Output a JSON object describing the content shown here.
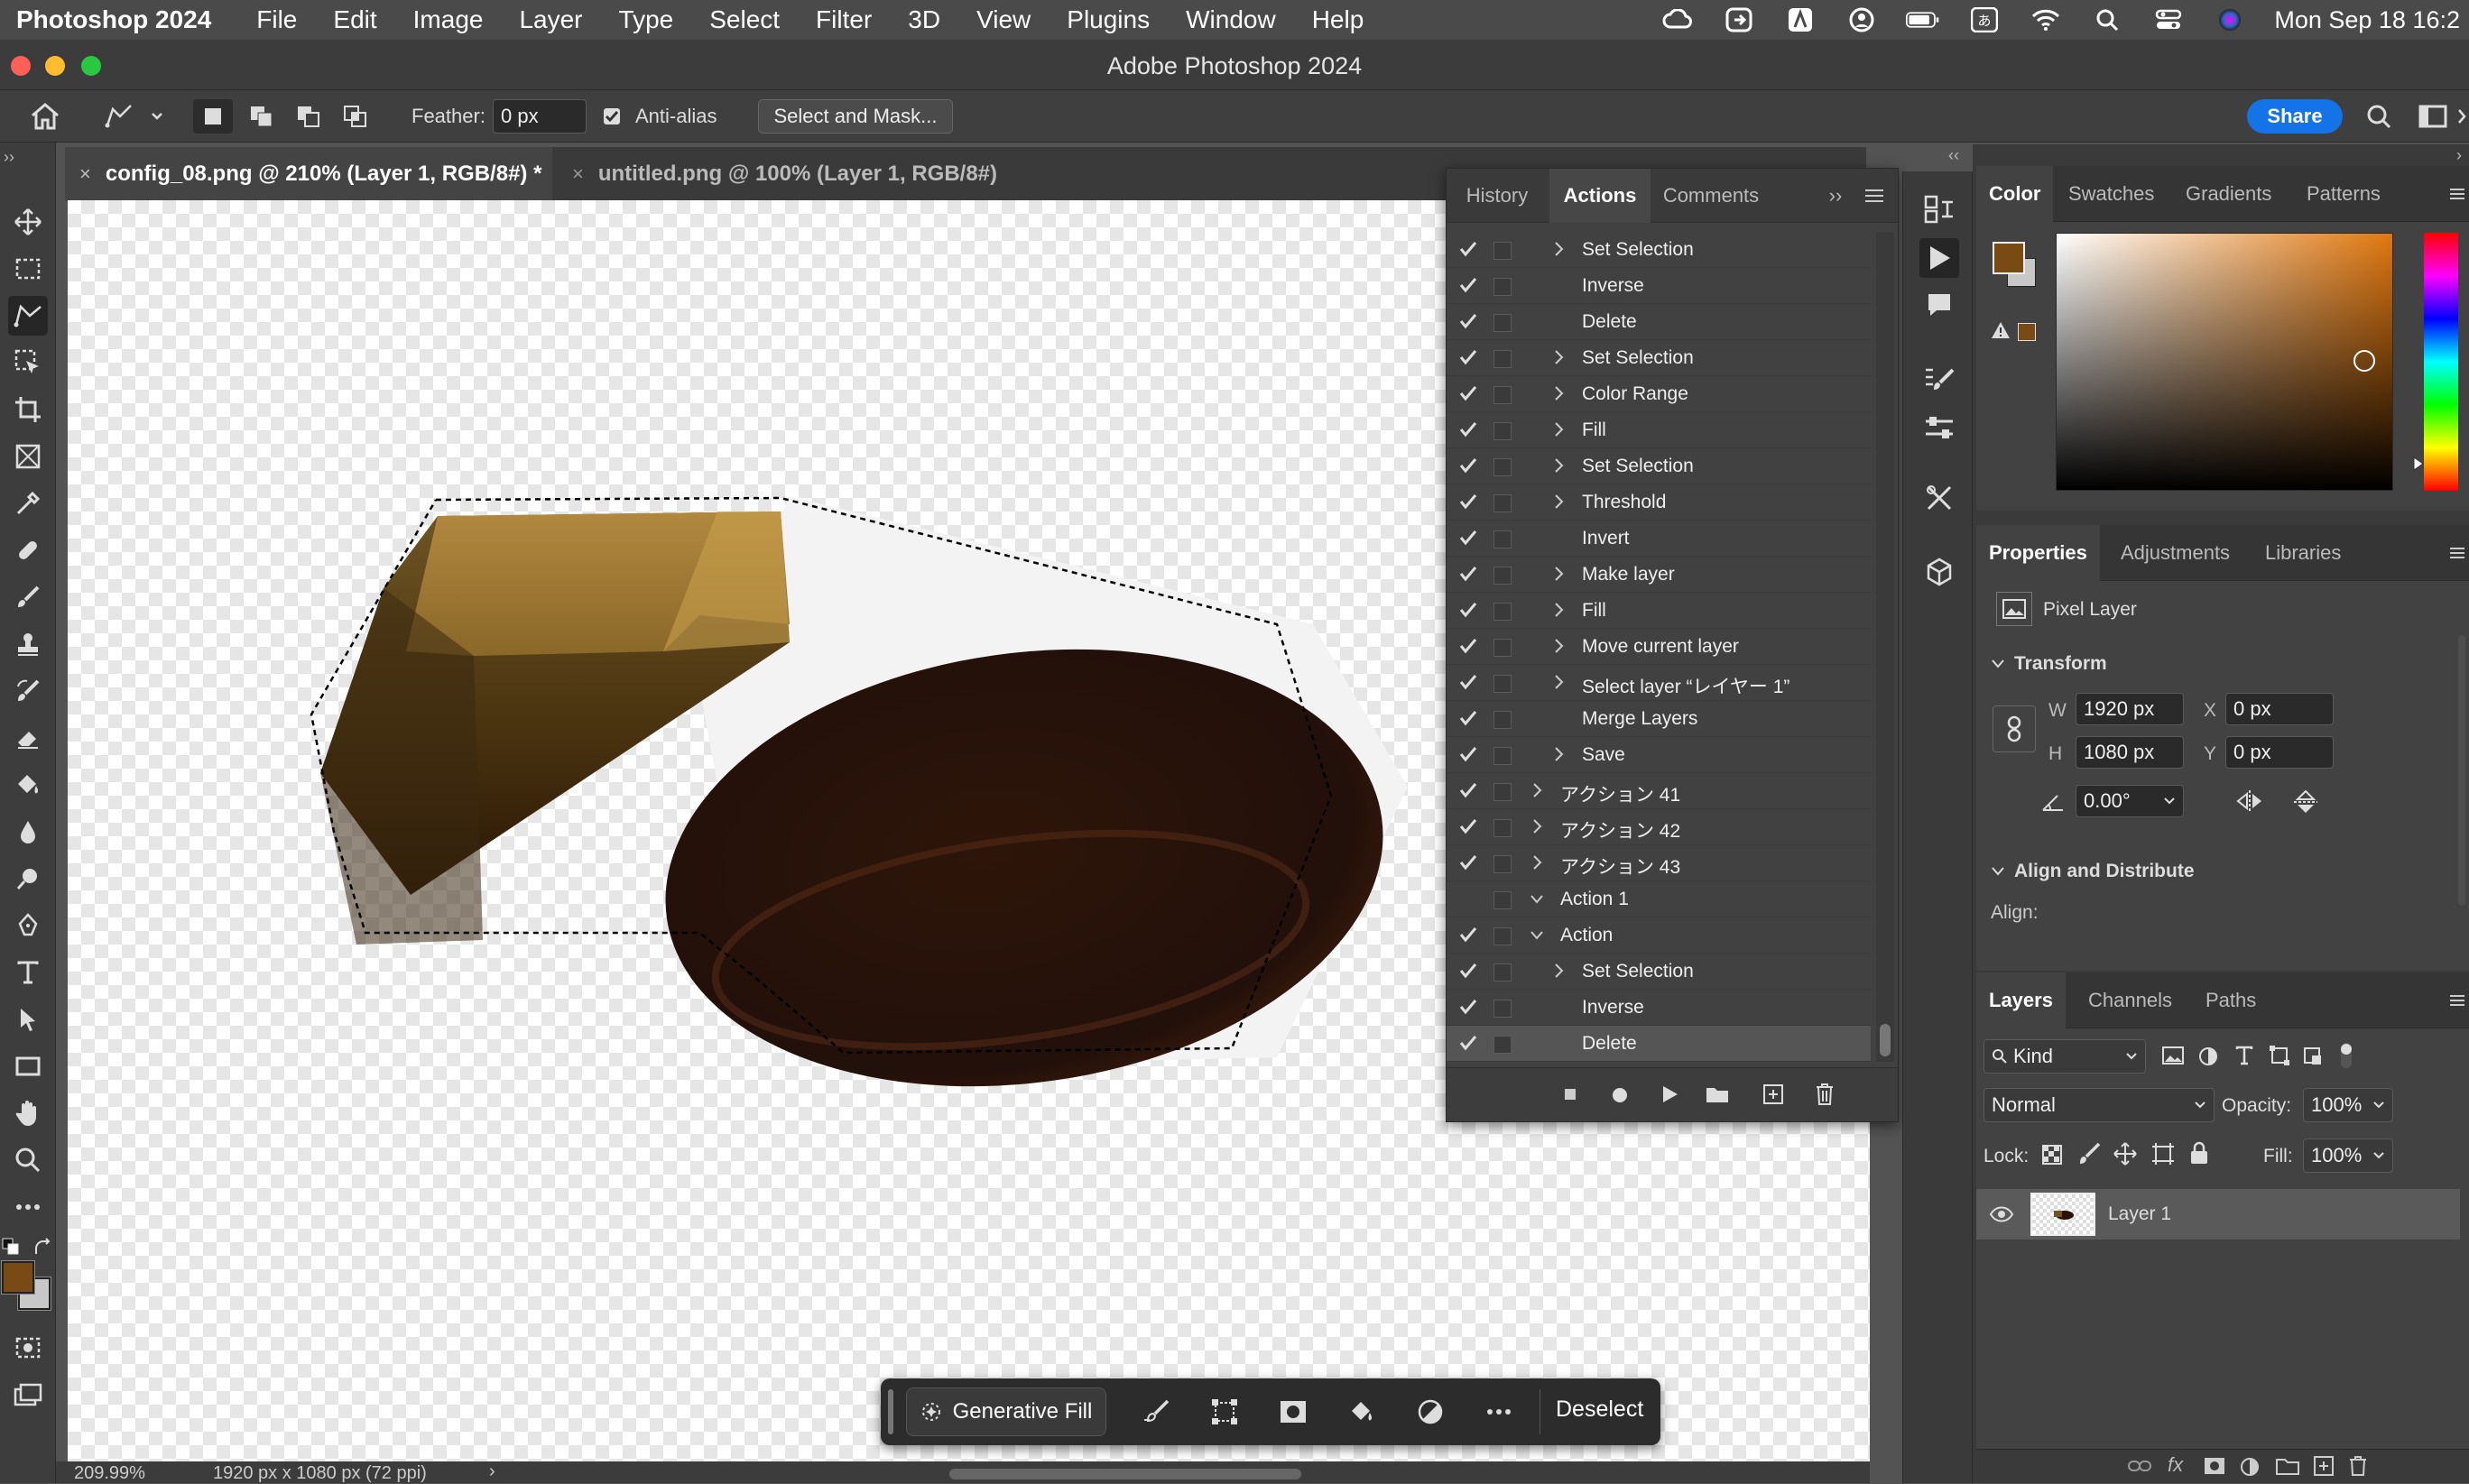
{
  "menubar": {
    "app_name": "Photoshop 2024",
    "menus": [
      "File",
      "Edit",
      "Image",
      "Layer",
      "Type",
      "Select",
      "Filter",
      "3D",
      "View",
      "Plugins",
      "Window",
      "Help"
    ],
    "clock": "Mon Sep 18  16:2"
  },
  "window": {
    "title": "Adobe Photoshop 2024"
  },
  "options_bar": {
    "feather_label": "Feather:",
    "feather_value": "0 px",
    "antialias_label": "Anti-alias",
    "antialias_checked": true,
    "select_mask_label": "Select and Mask...",
    "share_label": "Share"
  },
  "doc_tabs": [
    {
      "label": "config_08.png @ 210% (Layer 1, RGB/8#) *",
      "active": true
    },
    {
      "label": "untitled.png @ 100% (Layer 1, RGB/8#)",
      "active": false
    }
  ],
  "status": {
    "zoom": "209.99%",
    "doc_info": "1920 px x 1080 px (72 ppi)"
  },
  "actions_panel": {
    "tabs": [
      "History",
      "Actions",
      "Comments"
    ],
    "active_tab": "Actions",
    "rows": [
      {
        "label": "Set Selection",
        "expand": true,
        "level": 2
      },
      {
        "label": "Inverse",
        "expand": false,
        "level": 2
      },
      {
        "label": "Delete",
        "expand": false,
        "level": 2
      },
      {
        "label": "Set Selection",
        "expand": true,
        "level": 2
      },
      {
        "label": "Color Range",
        "expand": true,
        "level": 2
      },
      {
        "label": "Fill",
        "expand": true,
        "level": 2
      },
      {
        "label": "Set Selection",
        "expand": true,
        "level": 2
      },
      {
        "label": "Threshold",
        "expand": true,
        "level": 2
      },
      {
        "label": "Invert",
        "expand": false,
        "level": 2
      },
      {
        "label": "Make layer",
        "expand": true,
        "level": 2
      },
      {
        "label": "Fill",
        "expand": true,
        "level": 2
      },
      {
        "label": "Move current layer",
        "expand": true,
        "level": 2
      },
      {
        "label": "Select layer “レイヤー 1”",
        "expand": true,
        "level": 2
      },
      {
        "label": "Merge Layers",
        "expand": false,
        "level": 2
      },
      {
        "label": "Save",
        "expand": true,
        "level": 2
      },
      {
        "label": "アクション 41",
        "expand": true,
        "level": 1
      },
      {
        "label": "アクション 42",
        "expand": true,
        "level": 1
      },
      {
        "label": "アクション 43",
        "expand": true,
        "level": 1
      },
      {
        "label": "Action 1",
        "expand": true,
        "open": true,
        "level": 1,
        "nocheck": true
      },
      {
        "label": "Action",
        "expand": true,
        "open": true,
        "level": 1
      },
      {
        "label": "Set Selection",
        "expand": true,
        "level": 2
      },
      {
        "label": "Inverse",
        "expand": false,
        "level": 2
      },
      {
        "label": "Delete",
        "expand": false,
        "level": 2,
        "selected": true
      }
    ]
  },
  "color_panel": {
    "tabs": [
      "Color",
      "Swatches",
      "Gradients",
      "Patterns"
    ],
    "foreground": "#7a4a14",
    "background": "#c8c8c8",
    "hue_color": "#e07810"
  },
  "properties_panel": {
    "tabs": [
      "Properties",
      "Adjustments",
      "Libraries"
    ],
    "layer_type": "Pixel Layer",
    "transform_label": "Transform",
    "w_label": "W",
    "w_value": "1920 px",
    "h_label": "H",
    "h_value": "1080 px",
    "x_label": "X",
    "x_value": "0 px",
    "y_label": "Y",
    "y_value": "0 px",
    "angle_value": "0.00°",
    "align_section": "Align and Distribute",
    "align_label": "Align:"
  },
  "layers_panel": {
    "tabs": [
      "Layers",
      "Channels",
      "Paths"
    ],
    "kind_label": "Kind",
    "blend_mode": "Normal",
    "opacity_label": "Opacity:",
    "opacity_value": "100%",
    "lock_label": "Lock:",
    "fill_label": "Fill:",
    "fill_value": "100%",
    "layers": [
      {
        "name": "Layer 1",
        "visible": true
      }
    ]
  },
  "context_bar": {
    "generative_fill": "Generative Fill",
    "deselect": "Deselect"
  }
}
